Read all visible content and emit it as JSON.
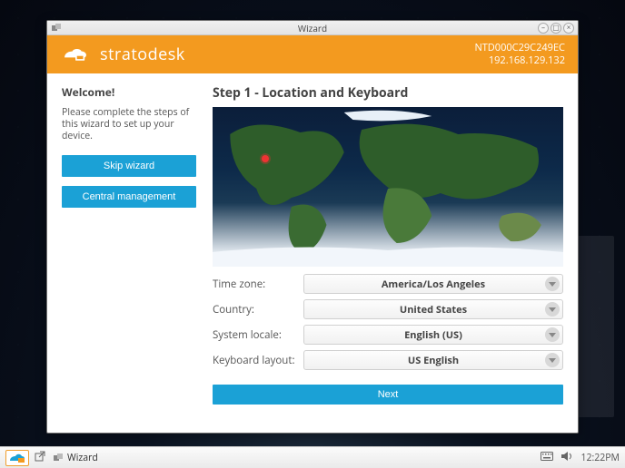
{
  "window": {
    "title": "Wizard"
  },
  "header": {
    "brand": "stratodesk",
    "device_id": "NTD000C29C249EC",
    "ip": "192.168.129.132"
  },
  "sidebar": {
    "welcome_title": "Welcome!",
    "welcome_text": "Please complete the steps of this wizard to set up your device.",
    "skip_label": "Skip wizard",
    "central_label": "Central management"
  },
  "main": {
    "step_title": "Step 1 - Location and Keyboard",
    "rows": [
      {
        "label": "Time zone:",
        "value": "America/Los Angeles"
      },
      {
        "label": "Country:",
        "value": "United States"
      },
      {
        "label": "System locale:",
        "value": "English (US)"
      },
      {
        "label": "Keyboard layout:",
        "value": "US English"
      }
    ],
    "next_label": "Next"
  },
  "taskbar": {
    "task_label": "Wizard",
    "clock": "12:22PM"
  },
  "colors": {
    "accent_orange": "#f39a1f",
    "accent_blue": "#1ba1d6"
  }
}
